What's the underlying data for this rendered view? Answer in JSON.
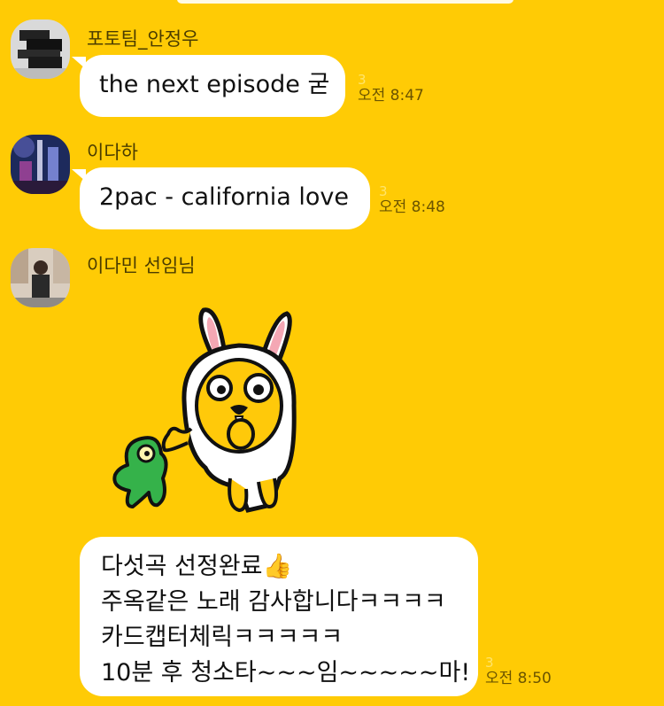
{
  "messages": [
    {
      "sender": "포토팀_안정우",
      "text": "the next episode 굳",
      "unread": "3",
      "time": "오전 8:47"
    },
    {
      "sender": "이다하",
      "text": "2pac - california love",
      "unread": "3",
      "time": "오전 8:48"
    },
    {
      "sender": "이다민 선임님",
      "lines": [
        "다섯곡 선정완료👍",
        "주옥같은 노래 감사합니다ㅋㅋㅋㅋ",
        "카드캡터체릭ㅋㅋㅋㅋㅋ",
        "10분 후 청소타~~~임~~~~~마!"
      ],
      "unread": "3",
      "time": "오전 8:50"
    }
  ],
  "colors": {
    "background": "#ffcb05",
    "bubble": "#ffffff",
    "unread": "#ffe46b"
  },
  "icons": [
    "avatar-photo-icon",
    "rabbit-sticker-icon"
  ]
}
